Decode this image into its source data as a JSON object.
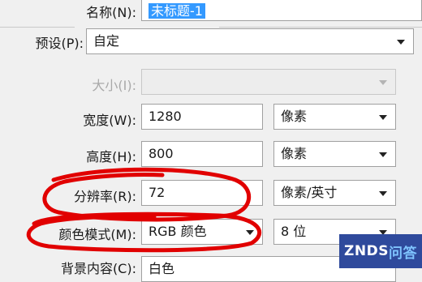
{
  "dialog": {
    "name": {
      "label": "名称(N):",
      "value": "未标题-1"
    },
    "preset": {
      "label": "预设(P):",
      "value": "自定"
    },
    "size": {
      "label": "大小(I):",
      "value": ""
    },
    "width": {
      "label": "宽度(W):",
      "value": "1280",
      "unit": "像素"
    },
    "height": {
      "label": "高度(H):",
      "value": "800",
      "unit": "像素"
    },
    "resolution": {
      "label": "分辨率(R):",
      "value": "72",
      "unit": "像素/英寸"
    },
    "color_mode": {
      "label": "颜色模式(M):",
      "value": "RGB 颜色",
      "depth": "8 位"
    },
    "background": {
      "label": "背景内容(C):",
      "value": "白色"
    }
  },
  "annotation": {
    "color": "#e10000"
  },
  "watermark": {
    "brand": "ZNDS",
    "suffix": "问答"
  }
}
